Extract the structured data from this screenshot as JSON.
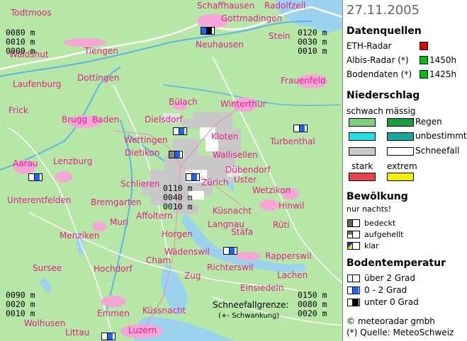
{
  "date": "27.11.2005",
  "towns": [
    "Todtmoos",
    "Schaffhausen",
    "Radolfzell",
    "Gottmadingen",
    "Stein",
    "Neuhausen",
    "Waldshut",
    "Tiengen",
    "Laufenburg",
    "Dottingen",
    "Frauenfeld",
    "Bülach",
    "Winterthur",
    "Frick",
    "Brugg",
    "Baden",
    "Dielsdorf",
    "Kloten",
    "Wettingen",
    "Dietikon",
    "Wallisellen",
    "Turbenthal",
    "Aarau",
    "Lenzburg",
    "Dübendorf",
    "Uster",
    "Schlieren",
    "Zürich",
    "Wetzikon",
    "Unterentfelden",
    "Bremgarten",
    "Hinwil",
    "Affoltern",
    "Küsnacht",
    "Muri",
    "Langnau",
    "Rüti",
    "Menziken",
    "Horgen",
    "Stäfa",
    "Wädenswil",
    "Rapperswil",
    "Sursee",
    "Hochdorf",
    "Cham",
    "Richterswil",
    "Zug",
    "Lachen",
    "Einsiedeln",
    "Emmen",
    "Küssnacht",
    "Wolhusen",
    "Littau",
    "Luzern"
  ],
  "readouts": {
    "nw": [
      "0080 m",
      "0010 m",
      "0000 m"
    ],
    "ne": [
      "0120 m",
      "0030 m",
      "0010 m"
    ],
    "center": [
      "0110 m",
      "0040 m",
      "0010 m"
    ],
    "sw": [
      "0090 m",
      "0020 m",
      "0010 m"
    ],
    "se": [
      "0150 m",
      "0080 m",
      "0020 m"
    ]
  },
  "snowline_label": "Schneefallgrenze:",
  "snowline_sub": "(+- Schwankung)",
  "colors": {
    "map_bg": "#b7e7a7",
    "town": "#e2208a",
    "lake": "#9bd2ee",
    "border": "#ffffff",
    "river": "#5ab6e8",
    "precip_snow": "#c8c8c8",
    "precip_snow_light": "#e2e2e2",
    "ground_snow2": "#0000ff",
    "ground_cold": "#000000"
  },
  "legend": {
    "sources_title": "Datenquellen",
    "sources": [
      {
        "label": "ETH-Radar",
        "color": "#e00000",
        "time": ""
      },
      {
        "label": "Albis-Radar (*)",
        "color": "#00c000",
        "time": "1450h"
      },
      {
        "label": "Bodendaten (*)",
        "color": "#00c000",
        "time": "1425h"
      }
    ],
    "precip_title": "Niederschlag",
    "precip_header": [
      "schwach",
      "mässig"
    ],
    "precip_rows": [
      {
        "weak": "#7ecf7e",
        "moderate": "#1e9b3c",
        "label": "Regen"
      },
      {
        "weak": "#20e0e6",
        "moderate": "#15a89e",
        "label": "unbestimmt"
      },
      {
        "weak": "#c8c8c8",
        "moderate": "#ffffff",
        "label": "Schneefall"
      }
    ],
    "intense_header": [
      "stark",
      "extrem"
    ],
    "intense_colors": [
      "#e84646",
      "#f4f000"
    ],
    "cloud_title": "Bewölkung",
    "cloud_sub": "nur nachts!",
    "cloud_items": [
      {
        "label": "bedeckt",
        "icon": "cloud-overcast-icon"
      },
      {
        "label": "aufgehellt",
        "icon": "cloud-partial-icon"
      },
      {
        "label": "klar",
        "icon": "clear-sky-icon"
      }
    ],
    "ground_title": "Bodentemperatur",
    "ground_items": [
      {
        "label": "über 2 Grad",
        "color": "#ffffff"
      },
      {
        "label": "0 - 2 Grad",
        "color": "#1a64ff"
      },
      {
        "label": "unter 0 Grad",
        "color": "#000000"
      }
    ],
    "copyright": "© meteoradar gmbh",
    "source_note": "(*) Quelle: MeteoSchweiz"
  }
}
